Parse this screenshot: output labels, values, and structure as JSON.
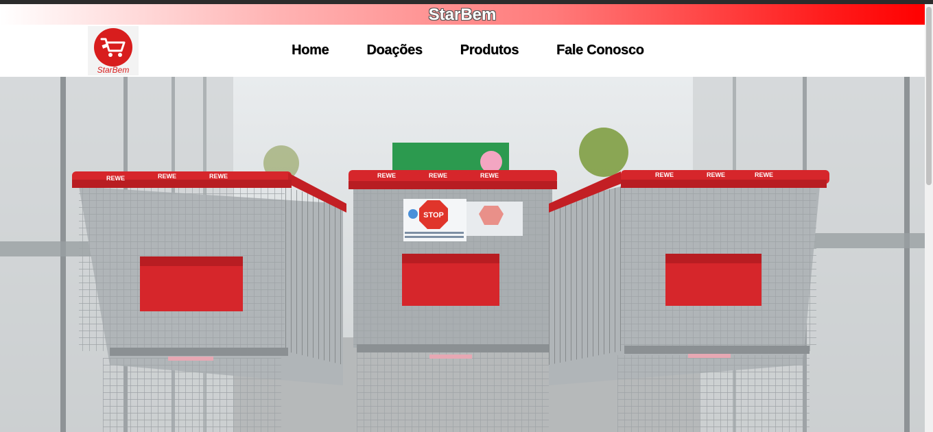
{
  "brand": {
    "title": "StarBem"
  },
  "logo": {
    "text": "StarBem",
    "icon": "shopping-cart-icon"
  },
  "nav": {
    "items": [
      {
        "label": "Home"
      },
      {
        "label": "Doações"
      },
      {
        "label": "Produtos"
      },
      {
        "label": "Fale Conosco"
      }
    ]
  },
  "hero": {
    "image": "shopping-carts-photo",
    "cart_brand_text": "REWE",
    "sign_text": "STOP"
  },
  "colors": {
    "accent": "#ff0000",
    "logo_red": "#d81d1d",
    "nav_text": "#000000"
  }
}
